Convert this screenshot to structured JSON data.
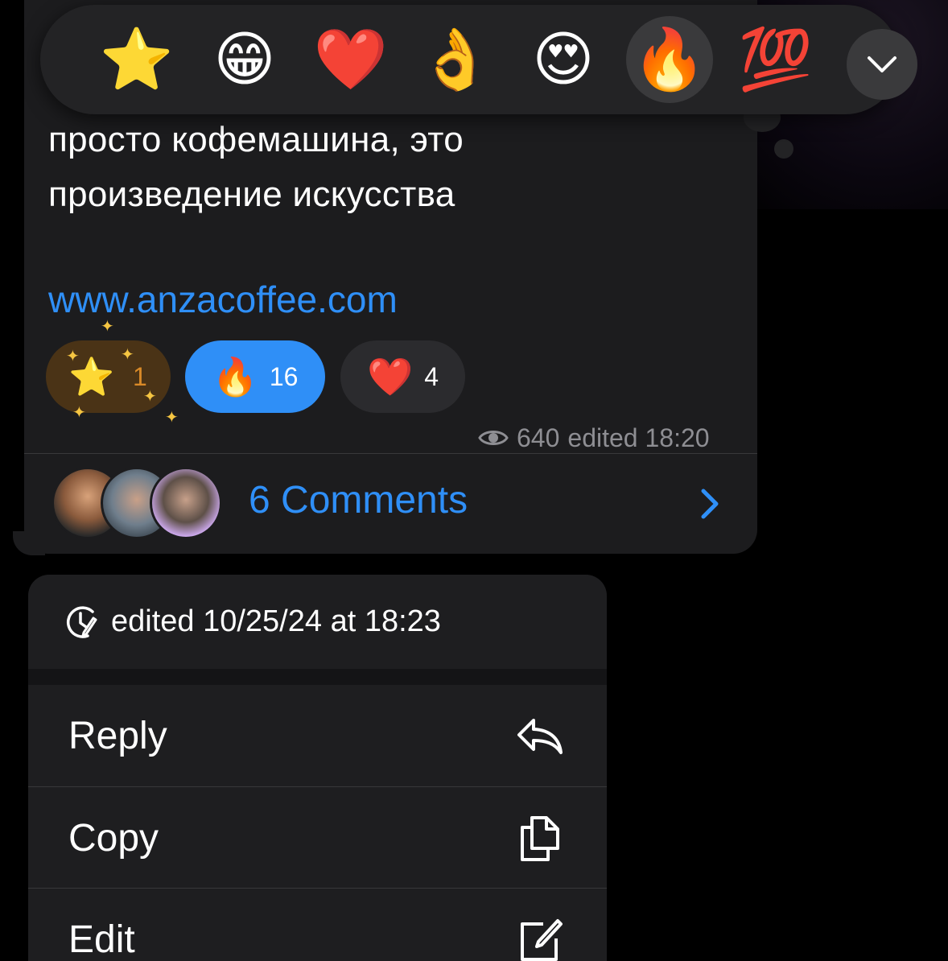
{
  "message": {
    "text_line1": "просто кофемашина, это",
    "text_line2": "произведение искусства",
    "link": "www.anzacoffee.com",
    "reactions": [
      {
        "emoji": "⭐",
        "count": "1",
        "name": "star"
      },
      {
        "emoji": "🔥",
        "count": "16",
        "name": "fire"
      },
      {
        "emoji": "❤️",
        "count": "4",
        "name": "heart"
      }
    ],
    "views": "640",
    "edited_time": "edited 18:20"
  },
  "comments": {
    "label": "6 Comments"
  },
  "picker": {
    "items": [
      {
        "emoji": "⭐",
        "name": "star"
      },
      {
        "emoji": "😁",
        "name": "grinning"
      },
      {
        "emoji": "❤️",
        "name": "heart"
      },
      {
        "emoji": "👌",
        "name": "ok-hand"
      },
      {
        "emoji": "😍",
        "name": "heart-eyes"
      },
      {
        "emoji": "🔥",
        "name": "fire"
      },
      {
        "emoji": "💯",
        "name": "hundred"
      }
    ],
    "selected": "fire"
  },
  "menu": {
    "edited_info": "edited 10/25/24 at 18:23",
    "items": [
      {
        "label": "Reply",
        "icon": "reply-icon"
      },
      {
        "label": "Copy",
        "icon": "copy-icon"
      },
      {
        "label": "Edit",
        "icon": "edit-icon"
      }
    ]
  },
  "colors": {
    "accent": "#2f8ff7",
    "bubble": "#1c1c1e",
    "menu": "#1e1e20",
    "meta": "#8e8e93"
  }
}
